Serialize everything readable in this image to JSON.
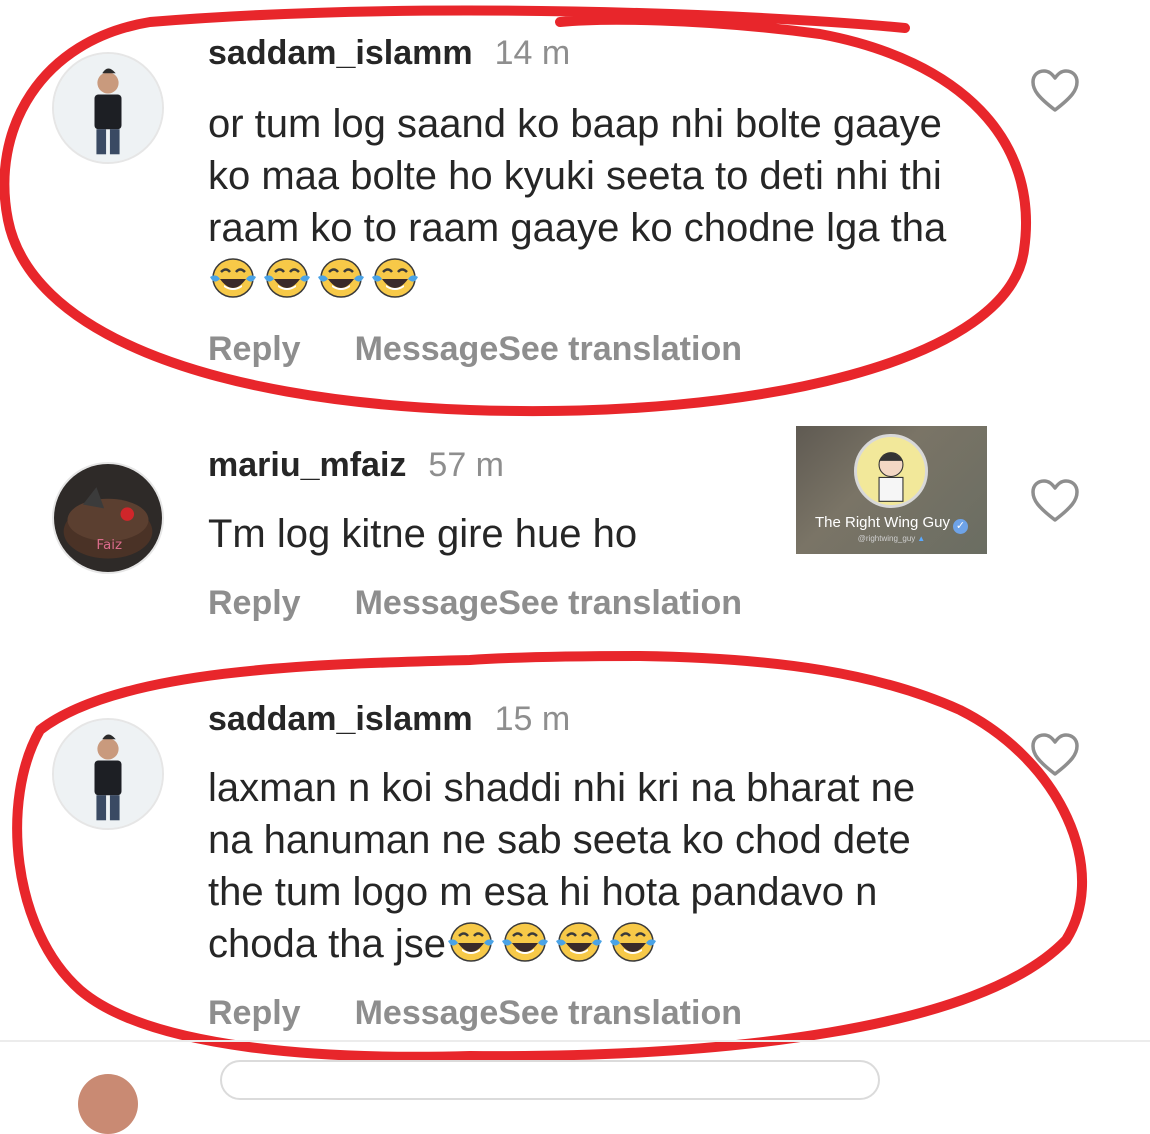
{
  "comments": [
    {
      "username": "saddam_islamm",
      "time": "14 m",
      "text": "or tum log saand ko baap nhi bolte gaaye ko maa bolte ho kyuki seeta to deti nhi thi raam ko to raam gaaye ko chodne lga tha",
      "emoji_count": 4,
      "emoji_name": "tears-of-joy-emoji",
      "reply_label": "Reply",
      "message_label": "Message",
      "translate_label": "See translation",
      "like_icon": "heart-outline-icon"
    },
    {
      "username": "mariu_mfaiz",
      "time": "57 m",
      "text": "Tm log kitne gire hue ho",
      "reply_label": "Reply",
      "message_label": "Message",
      "translate_label": "See translation",
      "like_icon": "heart-outline-icon"
    },
    {
      "username": "saddam_islamm",
      "time": "15 m",
      "text": "laxman n koi shaddi nhi kri na bharat ne na hanuman ne sab seeta ko chod dete the tum logo m esa hi hota pandavo n choda tha jse",
      "emoji_count": 4,
      "emoji_name": "tears-of-joy-emoji",
      "reply_label": "Reply",
      "message_label": "Message",
      "translate_label": "See translation",
      "like_icon": "heart-outline-icon"
    }
  ],
  "watermark": {
    "name": "The Right Wing Guy",
    "handle": "@rightwing_guy",
    "verified_icon": "verified-check-icon"
  },
  "colors": {
    "text": "#262626",
    "secondary": "#8e8e8e",
    "annotation_red": "#e8262b"
  }
}
